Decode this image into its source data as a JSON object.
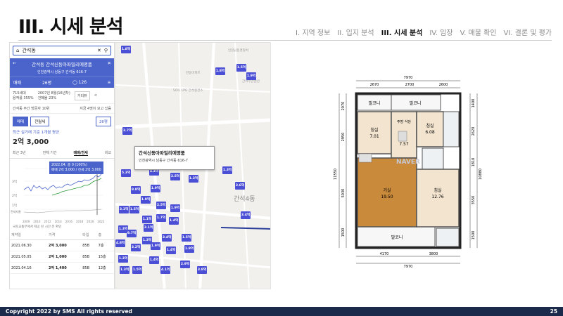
{
  "slide": {
    "title": "III. 시세 분석",
    "nav": [
      "I. 지역 정보",
      "II. 입지 분석",
      "III. 시세 분석",
      "IV. 임장",
      "V. 매물 확인",
      "VI. 결론 및 평가"
    ],
    "active_nav": 2,
    "footer": "Copyright 2022 by SMS All rights reserved",
    "page": "25"
  },
  "panel": {
    "search_text": "간석동",
    "header_title": "간석동 간석신동아파밀리에명품",
    "address": "인천광역시 남동구 간석동 616-7",
    "toolbar": {
      "deal": "매매",
      "size": "26평",
      "count": "126"
    },
    "info": {
      "households": "715세대",
      "floor_ratio": "용적률 355%",
      "built": "2007년 8월(16년차)",
      "parking": "건폐율 23%",
      "dist_btn": "거리뷰"
    },
    "rows": [
      {
        "l": "간석동 주간 방문자 10위",
        "r": "지금 4명이 보고 있음"
      }
    ],
    "trade_tabs": [
      "매매",
      "전월세"
    ],
    "size_select": "26평",
    "avg_label": "최근 실거래 기준 1개월 평균",
    "avg_price": "2억 3,000",
    "period_tabs": [
      "최근 3년",
      "전체 기간",
      "매매/전세",
      "비교"
    ],
    "tooltip": [
      "2022.04. 층 0 (100%)",
      "매매 2억 3,000 / 전세 2억 3,000"
    ],
    "axis": [
      "3억",
      "2억",
      "1억",
      "전세지율"
    ],
    "years": [
      "2009",
      "2010",
      "2012",
      "2014",
      "2016",
      "2018",
      "2020",
      "2022"
    ],
    "notes": "국토교통부에서 제공 된 시간 전 확인",
    "table": {
      "headers": [
        "계약일",
        "가격",
        "타입",
        "층"
      ],
      "rows": [
        [
          "2021.06.30",
          "2억 3,000",
          "85B",
          "7층"
        ],
        [
          "2021.05.05",
          "2억 1,000",
          "85B",
          "15층"
        ],
        [
          "2021.04.16",
          "2억 1,400",
          "85B",
          "12층"
        ]
      ]
    }
  },
  "map": {
    "card": {
      "name": "간석신동아파밀리에명품",
      "addr": "인천광역시 남동구 간석동 616-7"
    },
    "pins": [
      "1.8억",
      "3.7억",
      "1.5억",
      "2.5억",
      "1.8억",
      "1.9억",
      "5.3억",
      "9.8억",
      "1.9억",
      "1.9억",
      "1.3억",
      "4.4억",
      "2.5억",
      "1.3억",
      "2.6억",
      "1.5억",
      "3.1억",
      "1.7억",
      "2.1억",
      "1.4억",
      "1.9억",
      "3.4억",
      "1.3억",
      "9.7억",
      "1.3억",
      "3.2억",
      "1.9억",
      "3.4억",
      "1.5억",
      "1.4억",
      "1.4억",
      "2.9억",
      "1.3억",
      "4.8억",
      "3.8억",
      "1.1억",
      "1.9억",
      "4.1억",
      "1.5억",
      "1.3억"
    ],
    "labels": [
      "간석4동",
      "한동아파트",
      "SOIL LPG 간석충전소",
      "간석주안맨션",
      "인천남동경찰서"
    ]
  },
  "plan": {
    "top_total": "7970",
    "top_dims": [
      "2670",
      "2700",
      "2600"
    ],
    "bottom_total": "7970",
    "bottom_dims": [
      "4170",
      "3800"
    ],
    "left_total": "11550",
    "left_dims": [
      "2070",
      "2950",
      "5030",
      "1500"
    ],
    "right_total": "10880",
    "right_dims": [
      "1400",
      "2620",
      "1810",
      "3550",
      "1500"
    ],
    "rooms": [
      {
        "name": "발코니",
        "area": ""
      },
      {
        "name": "발코니",
        "area": ""
      },
      {
        "name": "침실",
        "area": "7.01"
      },
      {
        "name": "주방\n식당",
        "area": "7.57"
      },
      {
        "name": "침실",
        "area": "6.08"
      },
      {
        "name": "거실",
        "area": "19.50"
      },
      {
        "name": "침실",
        "area": "12.76"
      },
      {
        "name": "발코니",
        "area": ""
      }
    ],
    "watermark": "NAVER"
  }
}
